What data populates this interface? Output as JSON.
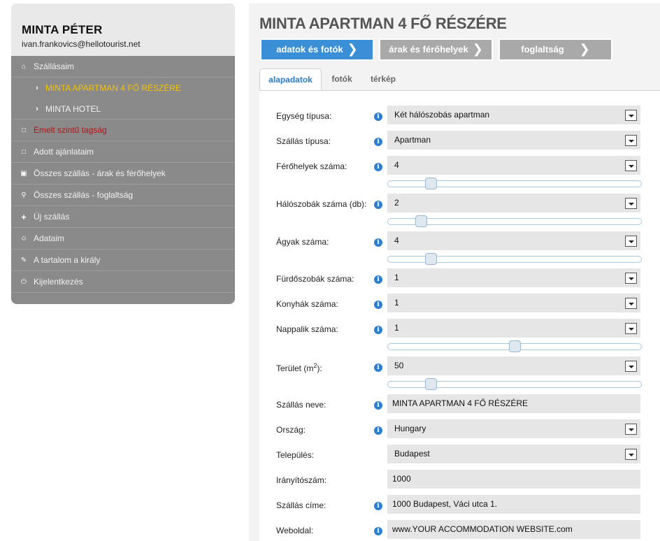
{
  "user": {
    "name": "MINTA PÉTER",
    "email": "ivan.frankovics@hellotourist.net"
  },
  "sidebar": {
    "items": [
      {
        "label": "Szállásaim",
        "icon": "home-icon"
      },
      {
        "label": "MINTA APARTMAN 4 FŐ RÉSZÉRE",
        "icon": "chevron-right-icon",
        "active": true
      },
      {
        "label": "MINTA HOTEL",
        "icon": "chevron-right-icon"
      },
      {
        "label": "Emelt szintű tagság",
        "icon": "document-icon",
        "color": "#b81212"
      },
      {
        "label": "Adott ajánlataim",
        "icon": "document-icon"
      },
      {
        "label": "Összes szállás - árak és férőhelyek",
        "icon": "bag-icon"
      },
      {
        "label": "Összes szállás - foglaltság",
        "icon": "key-icon"
      },
      {
        "label": "Új szállás",
        "icon": "plus-icon"
      },
      {
        "label": "Adataim",
        "icon": "user-icon"
      },
      {
        "label": "A tartalom a király",
        "icon": "pencil-icon"
      },
      {
        "label": "Kijelentkezés",
        "icon": "power-icon"
      }
    ]
  },
  "page": {
    "title": "MINTA APARTMAN 4 FŐ RÉSZÉRE"
  },
  "steps": [
    {
      "label": "adatok és fotók",
      "active": true
    },
    {
      "label": "árak és férőhelyek"
    },
    {
      "label": "foglaltság"
    }
  ],
  "tabs": [
    {
      "label": "alapadatok",
      "active": true
    },
    {
      "label": "fotók"
    },
    {
      "label": "térkép"
    }
  ],
  "form": {
    "unit_type": {
      "label": "Egység típusa:",
      "value": "Két hálószobás apartman"
    },
    "stay_type": {
      "label": "Szállás típusa:",
      "value": "Apartman"
    },
    "capacity": {
      "label": "Férőhelyek száma:",
      "value": "4",
      "slider_fraction": 0.17
    },
    "bedrooms": {
      "label": "Hálószobák száma (db):",
      "value": "2",
      "slider_fraction": 0.13
    },
    "beds": {
      "label": "Ágyak száma:",
      "value": "4",
      "slider_fraction": 0.17
    },
    "bathrooms": {
      "label": "Fürdőszobák száma:",
      "value": "1"
    },
    "kitchens": {
      "label": "Konyhák száma:",
      "value": "1"
    },
    "livingrooms": {
      "label": "Nappalik száma:",
      "value": "1",
      "slider_fraction": 0.5
    },
    "area": {
      "label_pre": "Terület (m",
      "label_sup": "2",
      "label_post": "):",
      "value": "50",
      "slider_fraction": 0.17
    },
    "name": {
      "label": "Szállás neve:",
      "value": "MINTA APARTMAN 4 FŐ RÉSZÉRE"
    },
    "country": {
      "label": "Ország:",
      "value": "Hungary"
    },
    "city": {
      "label": "Település:",
      "value": "Budapest"
    },
    "zip": {
      "label": "Irányítószám:",
      "value": "1000"
    },
    "address": {
      "label": "Szállás címe:",
      "value": "1000 Budapest, Váci utca 1."
    },
    "website": {
      "label": "Weboldal:",
      "value": "www.YOUR ACCOMMODATION WEBSITE.com"
    }
  },
  "colors": {
    "accent": "#3a8fd6",
    "sidebar_bg": "#8a8a8a",
    "active_item": "#f4c200",
    "premium_item": "#b81212",
    "info_icon": "#2d7fd0"
  }
}
